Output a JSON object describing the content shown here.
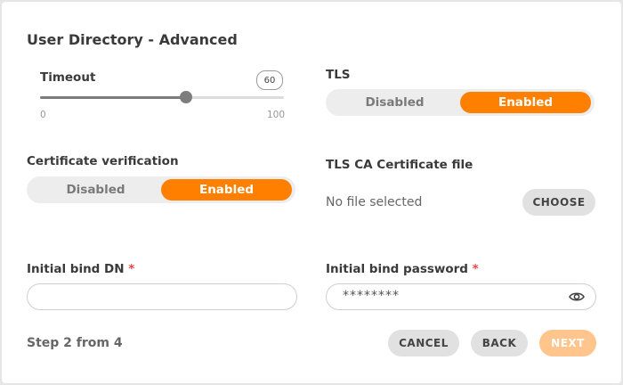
{
  "dialog": {
    "title": "User Directory - Advanced"
  },
  "timeout": {
    "label": "Timeout",
    "value": "60",
    "min": "0",
    "max": "100",
    "fill_fraction": 0.6
  },
  "tls": {
    "label": "TLS",
    "options": [
      "Disabled",
      "Enabled"
    ],
    "selected": "Enabled"
  },
  "cert_verification": {
    "label": "Certificate verification",
    "options": [
      "Disabled",
      "Enabled"
    ],
    "selected": "Enabled"
  },
  "tls_ca_file": {
    "label": "TLS CA Certificate file",
    "status": "No file selected",
    "choose_label": "CHOOSE"
  },
  "bind_dn": {
    "label": "Initial bind DN",
    "required_mark": "*",
    "value": ""
  },
  "bind_password": {
    "label": "Initial bind password",
    "required_mark": "*",
    "value": "********",
    "reveal_icon": "eye-icon"
  },
  "footer": {
    "step_text": "Step 2 from 4",
    "cancel_label": "CANCEL",
    "back_label": "BACK",
    "next_label": "NEXT"
  },
  "colors": {
    "accent": "#ff8000",
    "accent_disabled": "#ffc58c",
    "required": "#e64545"
  }
}
